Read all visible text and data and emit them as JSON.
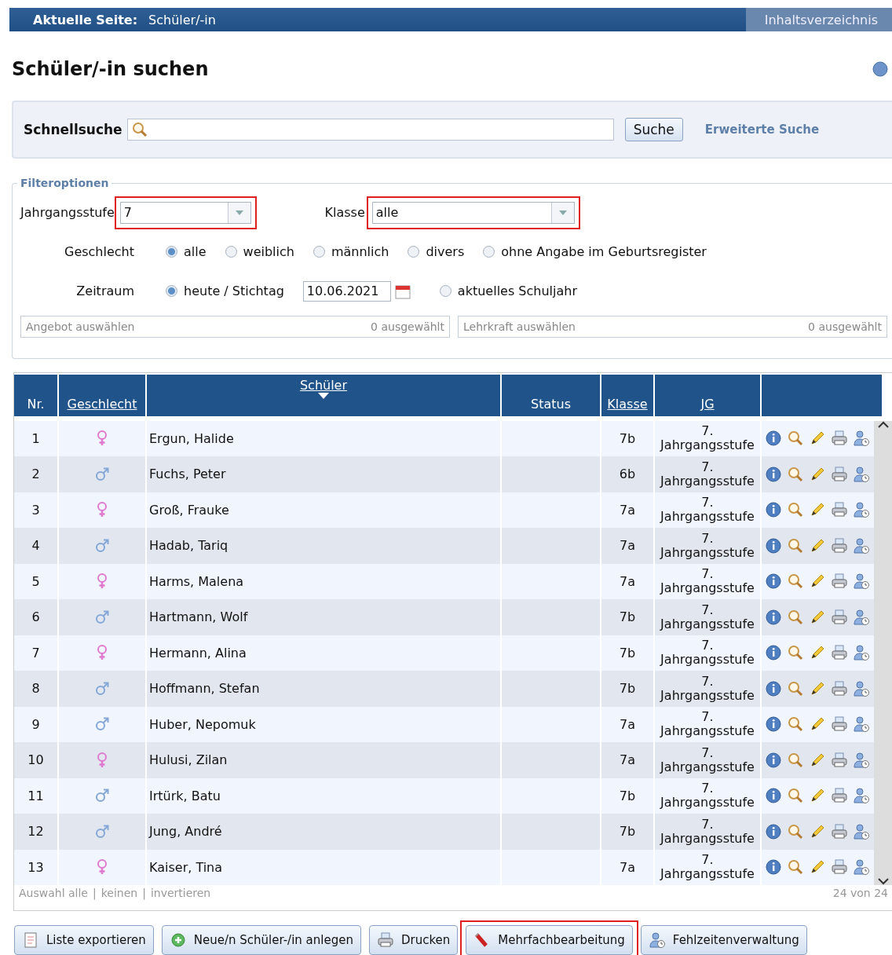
{
  "topbar": {
    "label": "Aktuelle Seite:",
    "page": "Schüler/-in",
    "toc": "Inhaltsverzeichnis"
  },
  "title": "Schüler/-in suchen",
  "quicksearch": {
    "label": "Schnellsuche",
    "button": "Suche",
    "advanced": "Erweiterte Suche"
  },
  "filter": {
    "legend": "Filteroptionen",
    "grade": {
      "label": "Jahrgangsstufe",
      "value": "7",
      "highlighted": true
    },
    "klasse": {
      "label": "Klasse",
      "value": "alle",
      "highlighted": true
    },
    "gender": {
      "label": "Geschlecht",
      "options": [
        {
          "label": "alle",
          "selected": true
        },
        {
          "label": "weiblich",
          "selected": false
        },
        {
          "label": "männlich",
          "selected": false
        },
        {
          "label": "divers",
          "selected": false
        },
        {
          "label": "ohne Angabe im Geburtsregister",
          "selected": false
        }
      ]
    },
    "period": {
      "label": "Zeitraum",
      "options": [
        {
          "label": "heute / Stichtag",
          "selected": true,
          "date": "10.06.2021"
        },
        {
          "label": "aktuelles Schuljahr",
          "selected": false
        }
      ]
    },
    "pickers": [
      {
        "placeholder": "Angebot auswählen",
        "count": "0 ausgewählt"
      },
      {
        "placeholder": "Lehrkraft auswählen",
        "count": "0 ausgewählt"
      }
    ]
  },
  "table": {
    "columns": [
      {
        "label": "Nr.",
        "link": false
      },
      {
        "label": "Geschlecht",
        "link": true
      },
      {
        "label": "Schüler",
        "link": true,
        "sorted": true
      },
      {
        "label": "Status",
        "link": false
      },
      {
        "label": "Klasse",
        "link": true
      },
      {
        "label": "JG",
        "link": true
      }
    ],
    "rows": [
      {
        "nr": "1",
        "kind": "female",
        "name": "Ergun, Halide",
        "klasse": "7b",
        "jg": "7. Jahrgangsstufe"
      },
      {
        "nr": "2",
        "kind": "male",
        "name": "Fuchs, Peter",
        "klasse": "6b",
        "jg": "7. Jahrgangsstufe"
      },
      {
        "nr": "3",
        "kind": "female",
        "name": "Groß, Frauke",
        "klasse": "7a",
        "jg": "7. Jahrgangsstufe"
      },
      {
        "nr": "4",
        "kind": "male",
        "name": "Hadab, Tariq",
        "klasse": "7a",
        "jg": "7. Jahrgangsstufe"
      },
      {
        "nr": "5",
        "kind": "female",
        "name": "Harms, Malena",
        "klasse": "7a",
        "jg": "7. Jahrgangsstufe"
      },
      {
        "nr": "6",
        "kind": "male",
        "name": "Hartmann, Wolf",
        "klasse": "7b",
        "jg": "7. Jahrgangsstufe"
      },
      {
        "nr": "7",
        "kind": "female",
        "name": "Hermann, Alina",
        "klasse": "7b",
        "jg": "7. Jahrgangsstufe"
      },
      {
        "nr": "8",
        "kind": "male",
        "name": "Hoffmann, Stefan",
        "klasse": "7b",
        "jg": "7. Jahrgangsstufe"
      },
      {
        "nr": "9",
        "kind": "male",
        "name": "Huber, Nepomuk",
        "klasse": "7a",
        "jg": "7. Jahrgangsstufe"
      },
      {
        "nr": "10",
        "kind": "female",
        "name": "Hulusi, Zilan",
        "klasse": "7a",
        "jg": "7. Jahrgangsstufe"
      },
      {
        "nr": "11",
        "kind": "male",
        "name": "Irtürk, Batu",
        "klasse": "7b",
        "jg": "7. Jahrgangsstufe"
      },
      {
        "nr": "12",
        "kind": "male",
        "name": "Jung, André",
        "klasse": "7b",
        "jg": "7. Jahrgangsstufe"
      },
      {
        "nr": "13",
        "kind": "female",
        "name": "Kaiser, Tina",
        "klasse": "7a",
        "jg": "7. Jahrgangsstufe"
      }
    ],
    "selection": [
      "Auswahl alle",
      "keinen",
      "invertieren"
    ],
    "separator": "|",
    "count": "24 von 24"
  },
  "buttons": [
    {
      "kind": "export",
      "label": "Liste exportieren",
      "highlighted": false
    },
    {
      "kind": "add",
      "label": "Neue/n Schüler-/in anlegen",
      "highlighted": false
    },
    {
      "kind": "print",
      "label": "Drucken",
      "highlighted": false
    },
    {
      "kind": "multi",
      "label": "Mehrfachbearbeitung",
      "highlighted": true
    },
    {
      "kind": "absence",
      "label": "Fehlzeitenverwaltung",
      "highlighted": false
    }
  ]
}
